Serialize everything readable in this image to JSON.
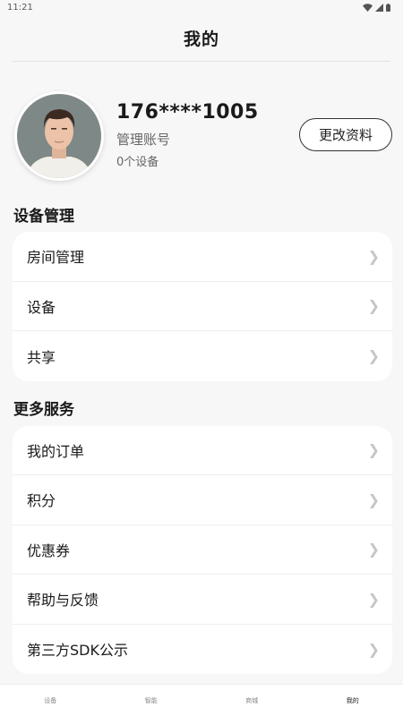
{
  "status_bar": {
    "time": "11:21"
  },
  "header": {
    "title": "我的"
  },
  "profile": {
    "phone": "176****1005",
    "role": "管理账号",
    "device_count": "0个设备",
    "edit_label": "更改资料"
  },
  "sections": [
    {
      "title": "设备管理",
      "items": [
        "房间管理",
        "设备",
        "共享"
      ]
    },
    {
      "title": "更多服务",
      "items": [
        "我的订单",
        "积分",
        "优惠券",
        "帮助与反馈",
        "第三方SDK公示"
      ]
    }
  ],
  "tabbar": {
    "tabs": [
      "设备",
      "智能",
      "商城",
      "我的"
    ],
    "active": "我的"
  },
  "icons": {
    "chevron": "chevron-right-icon",
    "wifi": "wifi-icon",
    "signal": "signal-icon",
    "battery": "battery-icon"
  }
}
